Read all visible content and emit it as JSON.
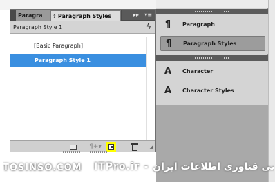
{
  "panel": {
    "tabs": [
      {
        "label": "Paragra",
        "active": false
      },
      {
        "label": "Paragraph Styles",
        "active": true
      }
    ],
    "tab_updown_glyph": "⇕",
    "collapse_glyph": "▸▸",
    "menu_glyph": "▾≡",
    "current_style": "Paragraph Style 1",
    "styles": [
      {
        "label": "[Basic Paragraph]",
        "selected": false
      },
      {
        "label": "Paragraph Style 1",
        "selected": true
      }
    ],
    "bottom_bar": {
      "icons": [
        "folder-icon",
        "clear-overrides-icon",
        "new-style-icon",
        "trash-icon"
      ],
      "highlight_color": "#ffff00"
    }
  },
  "dock": {
    "items": [
      {
        "label": "Paragraph",
        "icon": "pilcrow-icon",
        "selected": false
      },
      {
        "label": "Paragraph Styles",
        "icon": "paragraph-styles-icon",
        "selected": true
      },
      {
        "label": "Character",
        "icon": "character-icon",
        "selected": false
      },
      {
        "label": "Character Styles",
        "icon": "character-styles-icon",
        "selected": false
      }
    ]
  },
  "watermark": {
    "left": "TOSINSO.COM",
    "right": "ITPro.ir - انجمن تخصصی فناوری اطلاعات ایران"
  },
  "colors": {
    "selection": "#3a8fe0",
    "tabbar": "#4a4a4a",
    "panel_bg": "#bdbdbd"
  }
}
